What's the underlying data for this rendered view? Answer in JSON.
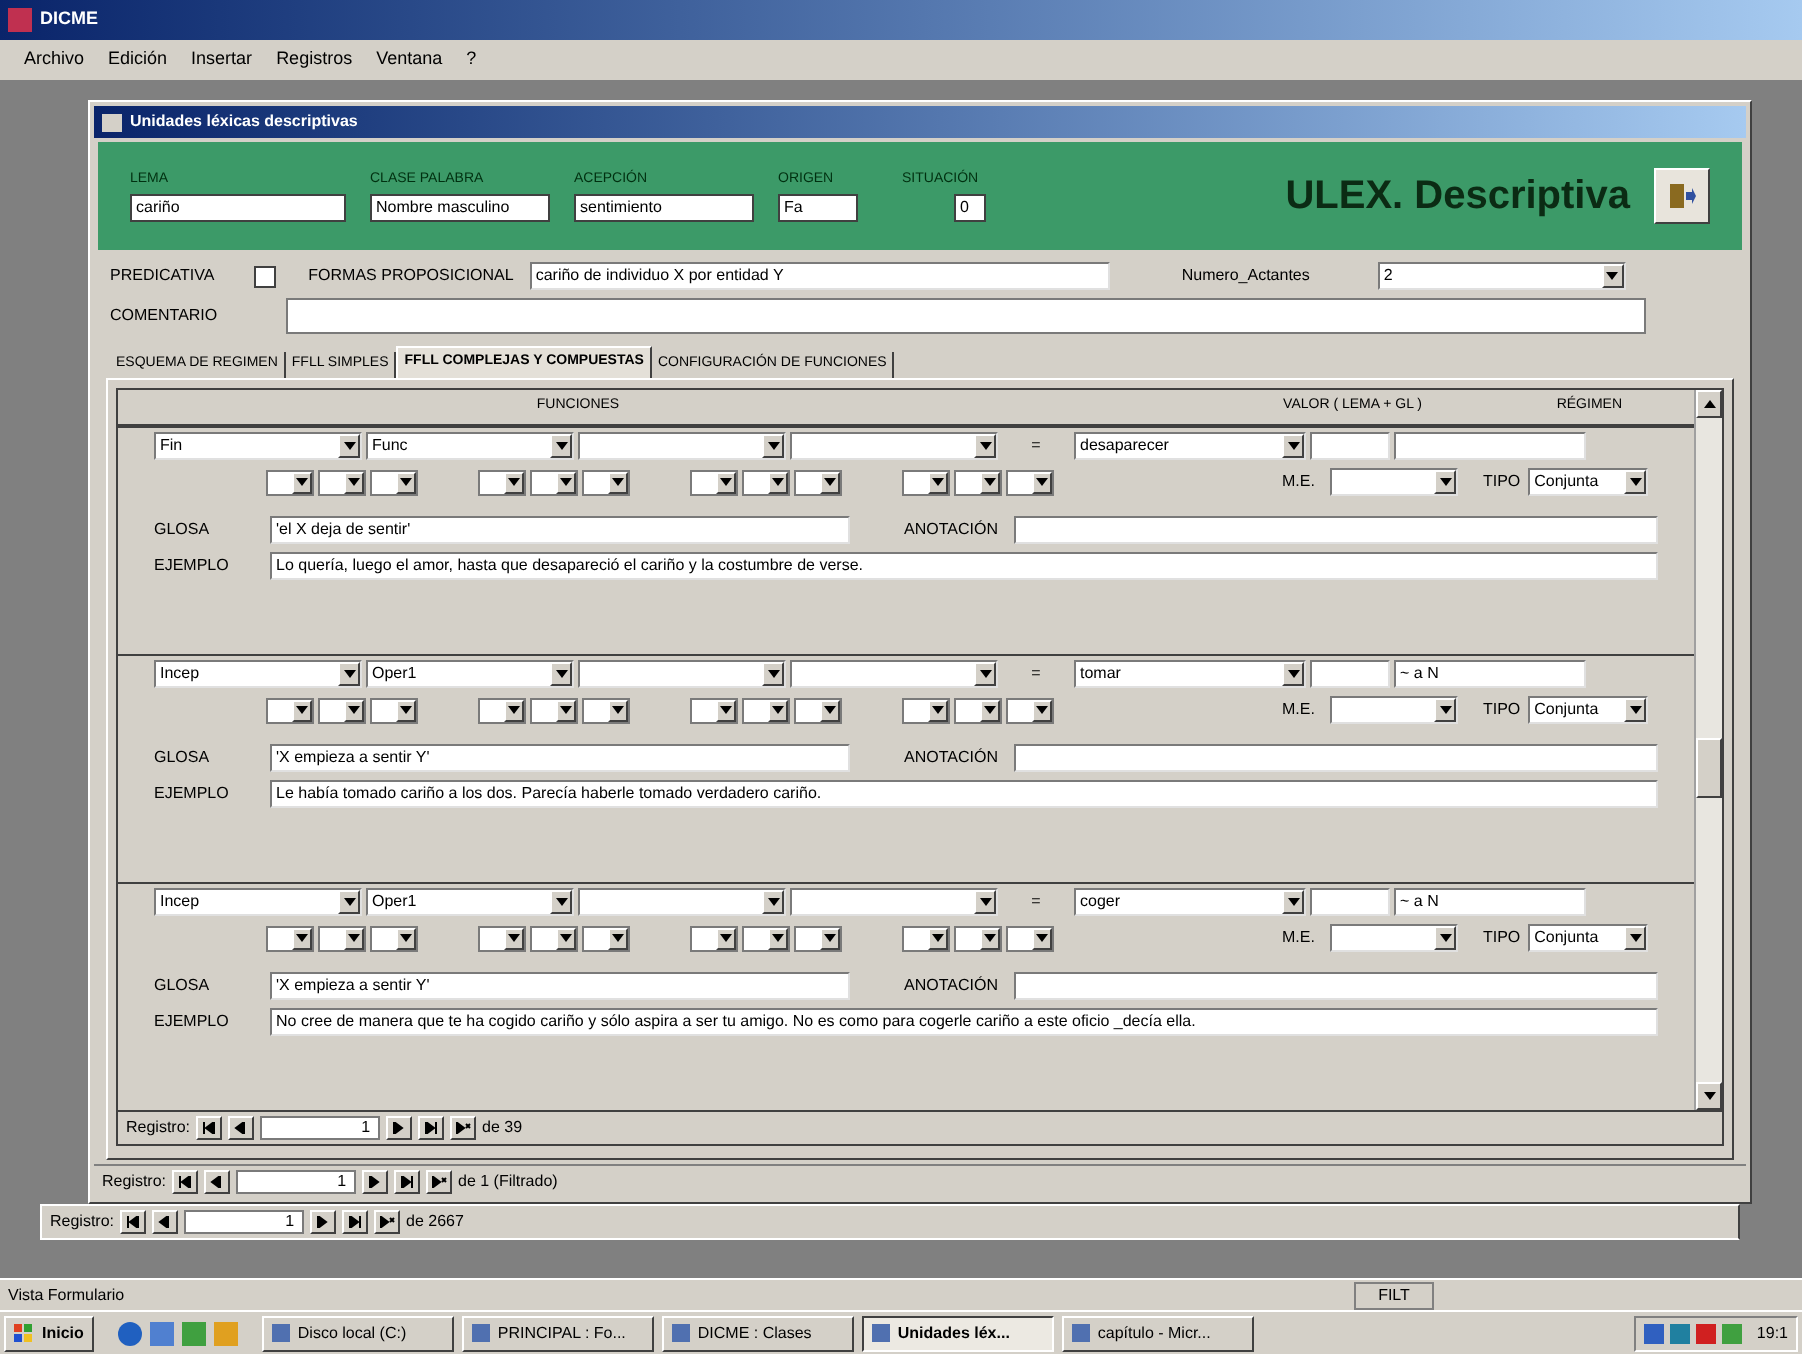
{
  "app": {
    "title": "DICME"
  },
  "menu": [
    "Archivo",
    "Edición",
    "Insertar",
    "Registros",
    "Ventana",
    "?"
  ],
  "form": {
    "title": "Unidades léxicas descriptivas",
    "header_fields": [
      {
        "label": "LEMA",
        "value": "cariño",
        "kind": "wide"
      },
      {
        "label": "CLASE PALABRA",
        "value": "Nombre masculino",
        "kind": "mid"
      },
      {
        "label": "ACEPCIÓN",
        "value": "sentimiento",
        "kind": "mid"
      },
      {
        "label": "ORIGEN",
        "value": "Fa",
        "kind": "short"
      },
      {
        "label": "SITUACIÓN",
        "value": "0",
        "kind": "tiny"
      }
    ],
    "brand": "ULEX. Descriptiva",
    "predicativa": {
      "label": "PREDICATIVA",
      "checked": false
    },
    "forma": {
      "label": "FORMAS PROPOSICIONAL",
      "value": "cariño de individuo X por entidad Y"
    },
    "actantes": {
      "label": "Numero_Actantes",
      "value": "2"
    },
    "comentario": {
      "label": "COMENTARIO"
    },
    "tabs": [
      {
        "label": "ESQUEMA DE REGIMEN",
        "selected": false
      },
      {
        "label": "FFLL SIMPLES",
        "selected": false
      },
      {
        "label": "FFLL COMPLEJAS Y COMPUESTAS",
        "selected": true
      },
      {
        "label": "CONFIGURACIÓN DE FUNCIONES",
        "selected": false
      }
    ],
    "subform": {
      "columns": [
        "FUNCIONES",
        "VALOR ( LEMA + GL )",
        "RÉGIMEN"
      ],
      "entries": [
        {
          "functions": [
            "Fin",
            "Func"
          ],
          "equals": "=",
          "value": "desaparecer",
          "me_label": "M.E.",
          "tipo_label": "TIPO",
          "tipo": "Conjunta",
          "glosa_label": "GLOSA",
          "glosa": "'el X deja de sentir'",
          "anot_label": "ANOTACIÓN",
          "ejemplo_label": "EJEMPLO",
          "ejemplo": "Lo quería, luego el amor, hasta que desapareció el cariño y la costumbre de verse."
        },
        {
          "functions": [
            "Incep",
            "Oper1"
          ],
          "equals": "=",
          "value": "tomar",
          "regimen": "~ a N",
          "me_label": "M.E.",
          "tipo_label": "TIPO",
          "tipo": "Conjunta",
          "glosa_label": "GLOSA",
          "glosa": "'X empieza a sentir Y'",
          "anot_label": "ANOTACIÓN",
          "ejemplo_label": "EJEMPLO",
          "ejemplo": "Le había tomado cariño a los dos. Parecía haberle tomado verdadero cariño."
        },
        {
          "functions": [
            "Incep",
            "Oper1"
          ],
          "equals": "=",
          "value": "coger",
          "regimen": "~ a N",
          "me_label": "M.E.",
          "tipo_label": "TIPO",
          "tipo": "Conjunta",
          "glosa_label": "GLOSA",
          "glosa": "'X empieza a sentir Y'",
          "anot_label": "ANOTACIÓN",
          "ejemplo_label": "EJEMPLO",
          "ejemplo": "No cree de manera que te ha cogido cariño y sólo aspira a ser tu amigo. No es como para cogerle cariño a este oficio _decía ella."
        }
      ],
      "nav": {
        "label": "Registro:",
        "current": "1",
        "total": "de 39"
      }
    },
    "nav": {
      "label": "Registro:",
      "current": "1",
      "total": "de 1 (Filtrado)"
    }
  },
  "back_nav": {
    "label": "Registro:",
    "current": "1",
    "total": "de 2667"
  },
  "status_bar": {
    "text": "Vista Formulario",
    "indicator": "FILT"
  },
  "taskbar": {
    "start": "Inicio",
    "items": [
      {
        "label": "Disco local (C:)",
        "selected": false
      },
      {
        "label": "PRINCIPAL : Fo...",
        "selected": false
      },
      {
        "label": "DICME : Clases",
        "selected": false
      },
      {
        "label": "Unidades léx...",
        "selected": true
      },
      {
        "label": "capítulo - Micr...",
        "selected": false
      }
    ],
    "clock": "19:1"
  }
}
